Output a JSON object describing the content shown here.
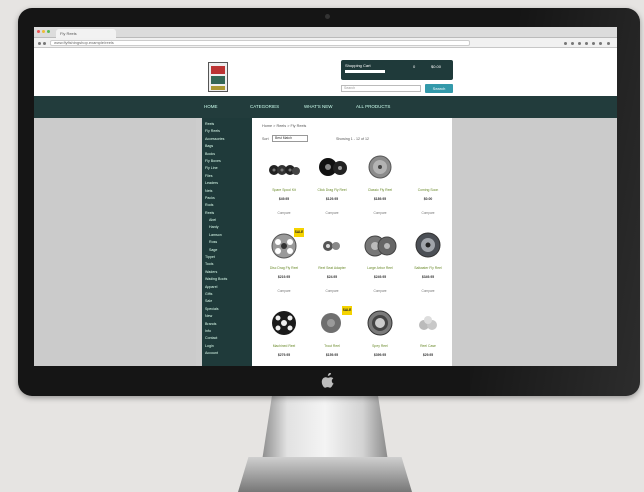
{
  "browser": {
    "tab_title": "Fly Reels",
    "url": "www.flyfishingshop.example/reels"
  },
  "header": {
    "cart_title": "Shopping Cart",
    "cart_items": "0",
    "cart_total": "$0.00",
    "search_placeholder": "Search",
    "search_button": "Search"
  },
  "nav": {
    "items": [
      "HOME",
      "CATEGORIES",
      "WHAT'S NEW",
      "ALL PRODUCTS"
    ]
  },
  "sidebar": {
    "items": [
      {
        "label": "Reels",
        "sub": false
      },
      {
        "label": "Fly Reels",
        "sub": false
      },
      {
        "label": "Accessories",
        "sub": false
      },
      {
        "label": "Bags",
        "sub": false
      },
      {
        "label": "Books",
        "sub": false
      },
      {
        "label": "Fly Boxes",
        "sub": false
      },
      {
        "label": "Fly Line",
        "sub": false
      },
      {
        "label": "Flies",
        "sub": false
      },
      {
        "label": "Leaders",
        "sub": false
      },
      {
        "label": "Nets",
        "sub": false
      },
      {
        "label": "Packs",
        "sub": false
      },
      {
        "label": "Rods",
        "sub": false
      },
      {
        "label": "Reels",
        "sub": false
      },
      {
        "label": "Abel",
        "sub": true
      },
      {
        "label": "Hardy",
        "sub": true
      },
      {
        "label": "Lamson",
        "sub": true
      },
      {
        "label": "Ross",
        "sub": true
      },
      {
        "label": "Sage",
        "sub": true
      },
      {
        "label": "Tippet",
        "sub": false
      },
      {
        "label": "Tools",
        "sub": false
      },
      {
        "label": "Waders",
        "sub": false
      },
      {
        "label": "Wading Boots",
        "sub": false
      },
      {
        "label": "Apparel",
        "sub": false
      },
      {
        "label": "Gifts",
        "sub": false
      },
      {
        "label": "Sale",
        "sub": false
      },
      {
        "label": "Specials",
        "sub": false
      },
      {
        "label": "New",
        "sub": false
      },
      {
        "label": "Brands",
        "sub": false
      },
      {
        "label": "Info",
        "sub": false
      },
      {
        "label": "Contact",
        "sub": false
      },
      {
        "label": "Login",
        "sub": false
      },
      {
        "label": "Account",
        "sub": false
      }
    ]
  },
  "content": {
    "breadcrumb": "Home > Reels > Fly Reels",
    "sort_label": "Sort",
    "sort_value": "Best Match",
    "showing": "Showing 1 - 12 of 12",
    "compare_label": "Compare",
    "badge_label": "SALE"
  },
  "products": [
    {
      "name": "Spare Spool Kit",
      "price": "$49.95",
      "badge": false,
      "kind": "spools"
    },
    {
      "name": "Click Drag Fly Reel",
      "price": "$129.95",
      "badge": false,
      "kind": "black"
    },
    {
      "name": "Classic Fly Reel",
      "price": "$189.95",
      "badge": false,
      "kind": "silver"
    },
    {
      "name": "Coming Soon",
      "price": "$0.00",
      "badge": false,
      "kind": "none"
    },
    {
      "name": "Disc Drag Fly Reel",
      "price": "$219.95",
      "badge": true,
      "kind": "ported"
    },
    {
      "name": "Reel Seat Adapter",
      "price": "$24.95",
      "badge": false,
      "kind": "small"
    },
    {
      "name": "Large Arbor Reel",
      "price": "$249.95",
      "badge": false,
      "kind": "twin"
    },
    {
      "name": "Saltwater Fly Reel",
      "price": "$349.95",
      "badge": false,
      "kind": "dark"
    },
    {
      "name": "Machined Reel",
      "price": "$279.95",
      "badge": false,
      "kind": "blackport"
    },
    {
      "name": "Trout Reel",
      "price": "$159.95",
      "badge": true,
      "kind": "gray"
    },
    {
      "name": "Spey Reel",
      "price": "$399.95",
      "badge": false,
      "kind": "bigsilver"
    },
    {
      "name": "Reel Case",
      "price": "$29.95",
      "badge": false,
      "kind": "light"
    }
  ]
}
